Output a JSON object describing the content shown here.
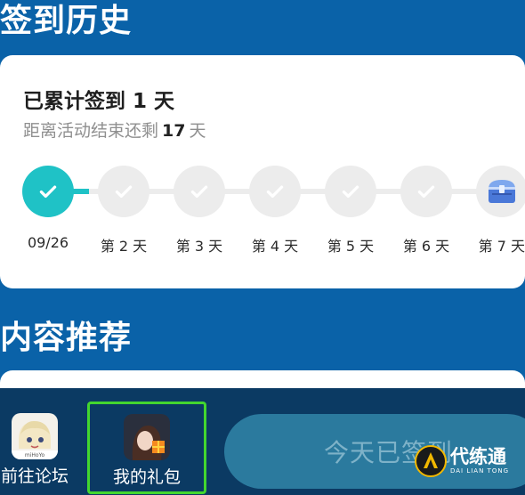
{
  "sections": {
    "signin_history": "签到历史",
    "recommended": "内容推荐"
  },
  "checkin": {
    "total_prefix": "已累计签到",
    "total_days": "1",
    "total_suffix": "天",
    "remaining_prefix": "距离活动结束还剩",
    "remaining_days": "17",
    "remaining_suffix": "天",
    "days": [
      {
        "label": "09/26",
        "state": "done"
      },
      {
        "label": "第 2 天",
        "state": "pending"
      },
      {
        "label": "第 3 天",
        "state": "pending"
      },
      {
        "label": "第 4 天",
        "state": "pending"
      },
      {
        "label": "第 5 天",
        "state": "pending"
      },
      {
        "label": "第 6 天",
        "state": "pending"
      },
      {
        "label": "第 7 天",
        "state": "chest"
      }
    ]
  },
  "bottom_nav": {
    "forum_label": "前往论坛",
    "gift_label": "我的礼包",
    "signed_label": "今天已签到"
  },
  "watermark": {
    "main": "代练通",
    "sub": "DAI LIAN TONG"
  },
  "colors": {
    "background": "#0a62a8",
    "accent": "#1fc2c6",
    "bottombar": "#0b3a63",
    "highlight_border": "#43d62f"
  }
}
